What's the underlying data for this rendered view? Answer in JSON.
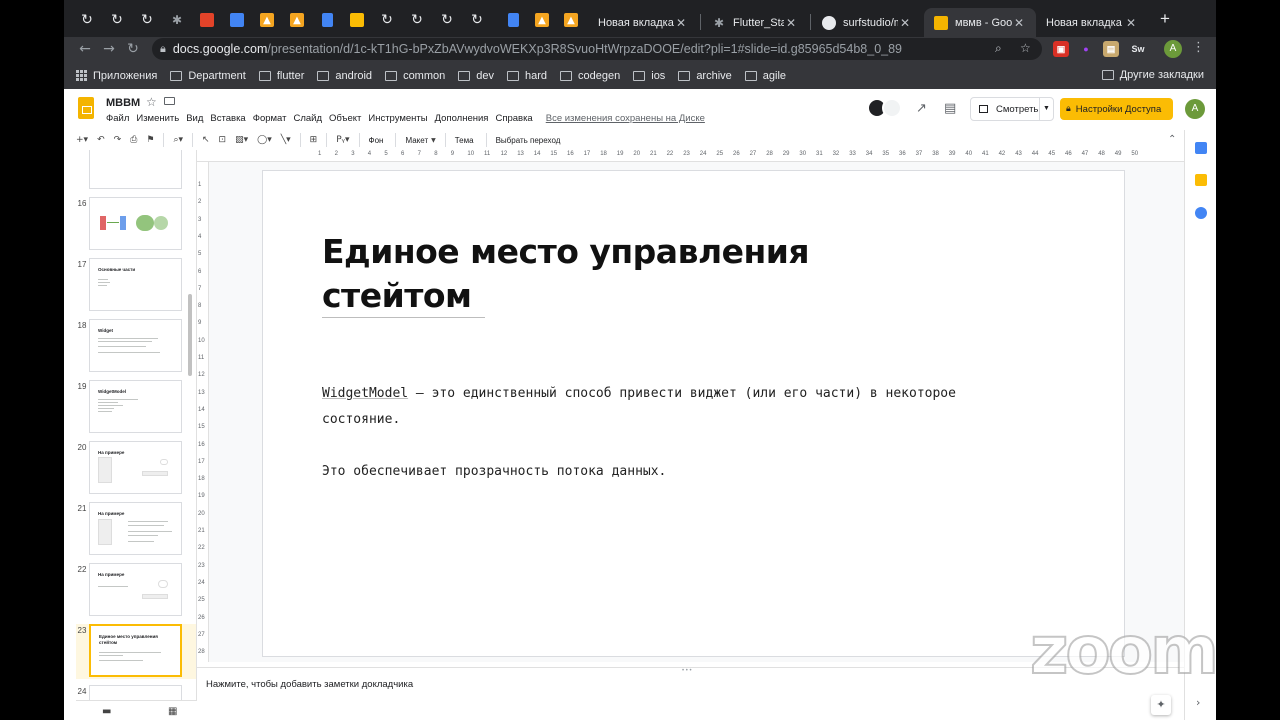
{
  "browser": {
    "tabs": [
      {
        "label": "Новая вкладка"
      },
      {
        "label": "Flutter_Stand"
      },
      {
        "label": "surfstudio/mv"
      },
      {
        "label": "мвмв - Goog"
      },
      {
        "label": "Новая вкладка"
      }
    ],
    "url_domain": "docs.google.com",
    "url_path": "/presentation/d/1c-kT1hG-bPxZbAVwydvoWEKXp3R8SvuoHtWrpzaDOOE/edit?pli=1#slide=id.g85965d54b8_0_89",
    "extension_label": "Sw",
    "profile_initial": "A",
    "bookmarks": [
      "Приложения",
      "Department",
      "flutter",
      "android",
      "common",
      "dev",
      "hard",
      "codegen",
      "ios",
      "archive",
      "agile"
    ],
    "other_bookmarks": "Другие закладки"
  },
  "app": {
    "doc_title": "МВВМ",
    "menu": [
      "Файл",
      "Изменить",
      "Вид",
      "Вставка",
      "Формат",
      "Слайд",
      "Объект",
      "Инструменты",
      "Дополнения",
      "Справка"
    ],
    "saved_status": "Все изменения сохранены на Диске",
    "present_label": "Смотреть",
    "share_label": "Настройки Доступа",
    "user_initial": "A"
  },
  "toolbar": {
    "background_label": "Фон",
    "layout_label": "Макет",
    "theme_label": "Тема",
    "transition_label": "Выбрать переход"
  },
  "filmstrip": {
    "slides": [
      {
        "number": "",
        "title": ""
      },
      {
        "number": "16",
        "title": ""
      },
      {
        "number": "17",
        "title": "Основные части"
      },
      {
        "number": "18",
        "title": "Widget"
      },
      {
        "number": "19",
        "title": "WidgetModel"
      },
      {
        "number": "20",
        "title": "На примере"
      },
      {
        "number": "21",
        "title": "На примере"
      },
      {
        "number": "22",
        "title": "На примере"
      },
      {
        "number": "23",
        "title": "Единое место управления стейтом"
      },
      {
        "number": "24",
        "title": ""
      }
    ]
  },
  "ruler": {
    "h_ticks": [
      "1",
      "2",
      "3",
      "4",
      "5",
      "6",
      "7",
      "8",
      "9",
      "10",
      "11",
      "12",
      "13",
      "14",
      "15",
      "16",
      "17",
      "18",
      "19",
      "20",
      "21",
      "22",
      "23",
      "24",
      "25",
      "26",
      "27",
      "28",
      "29",
      "30",
      "31",
      "32",
      "33",
      "34",
      "35",
      "36",
      "37",
      "38",
      "39",
      "40",
      "41",
      "42",
      "43",
      "44",
      "45",
      "46",
      "47",
      "48",
      "49",
      "50"
    ],
    "v_ticks": [
      "1",
      "2",
      "3",
      "4",
      "5",
      "6",
      "7",
      "8",
      "9",
      "10",
      "11",
      "12",
      "13",
      "14",
      "15",
      "16",
      "17",
      "18",
      "19",
      "20",
      "21",
      "22",
      "23",
      "24",
      "25",
      "26",
      "27",
      "28"
    ]
  },
  "slide": {
    "title_line1": "Единое место управления",
    "title_line2": "стейтом",
    "body_code": "WidgetModel",
    "body_rest": " — это единственный способ привести виджет (или его части) в некоторое состояние.",
    "body_p2": "Это обеспечивает прозрачность потока данных."
  },
  "notes": {
    "placeholder": "Нажмите, чтобы добавить заметки докладчика"
  },
  "watermark": "zoom"
}
